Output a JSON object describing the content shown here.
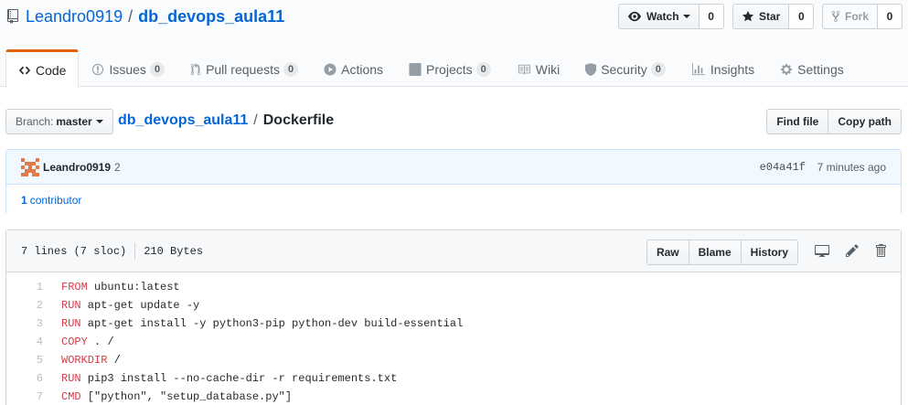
{
  "repo": {
    "owner": "Leandro0919",
    "name": "db_devops_aula11",
    "separator": "/"
  },
  "actions": {
    "watch": {
      "label": "Watch",
      "count": "0"
    },
    "star": {
      "label": "Star",
      "count": "0"
    },
    "fork": {
      "label": "Fork",
      "count": "0"
    }
  },
  "tabs": [
    {
      "label": "Code",
      "icon": "code-icon",
      "selected": true
    },
    {
      "label": "Issues",
      "count": "0",
      "icon": "issue-opened-icon"
    },
    {
      "label": "Pull requests",
      "count": "0",
      "icon": "git-pull-request-icon"
    },
    {
      "label": "Actions",
      "icon": "play-icon"
    },
    {
      "label": "Projects",
      "count": "0",
      "icon": "project-icon"
    },
    {
      "label": "Wiki",
      "icon": "book-icon"
    },
    {
      "label": "Security",
      "count": "0",
      "icon": "shield-icon"
    },
    {
      "label": "Insights",
      "icon": "graph-icon"
    },
    {
      "label": "Settings",
      "icon": "gear-icon"
    }
  ],
  "branch": {
    "prefix": "Branch:",
    "name": "master"
  },
  "breadcrumb": {
    "repo": "db_devops_aula11",
    "separator": "/",
    "file": "Dockerfile"
  },
  "file_actions": {
    "find": "Find file",
    "copy": "Copy path"
  },
  "commit": {
    "author": "Leandro0919",
    "count": "2",
    "sha": "e04a41f",
    "time": "7 minutes ago",
    "contributors_count": "1",
    "contributors_label": "contributor"
  },
  "file": {
    "lines_info": "7 lines (7 sloc)",
    "size": "210 Bytes",
    "buttons": {
      "raw": "Raw",
      "blame": "Blame",
      "history": "History"
    },
    "code": [
      {
        "n": "1",
        "kw": "FROM",
        "rest": " ubuntu:latest"
      },
      {
        "n": "2",
        "kw": "RUN",
        "rest": " apt-get update -y"
      },
      {
        "n": "3",
        "kw": "RUN",
        "rest": " apt-get install -y python3-pip python-dev build-essential"
      },
      {
        "n": "4",
        "kw": "COPY",
        "rest": " . /"
      },
      {
        "n": "5",
        "kw": "WORKDIR",
        "rest": " /"
      },
      {
        "n": "6",
        "kw": "RUN",
        "rest": " pip3 install --no-cache-dir -r requirements.txt"
      },
      {
        "n": "7",
        "kw": "CMD",
        "rest": " [\"python\", \"setup_database.py\"]"
      }
    ]
  },
  "colors": {
    "link": "#0366d6",
    "keyword": "#d73a49",
    "selected_tab_accent": "#e36209"
  }
}
